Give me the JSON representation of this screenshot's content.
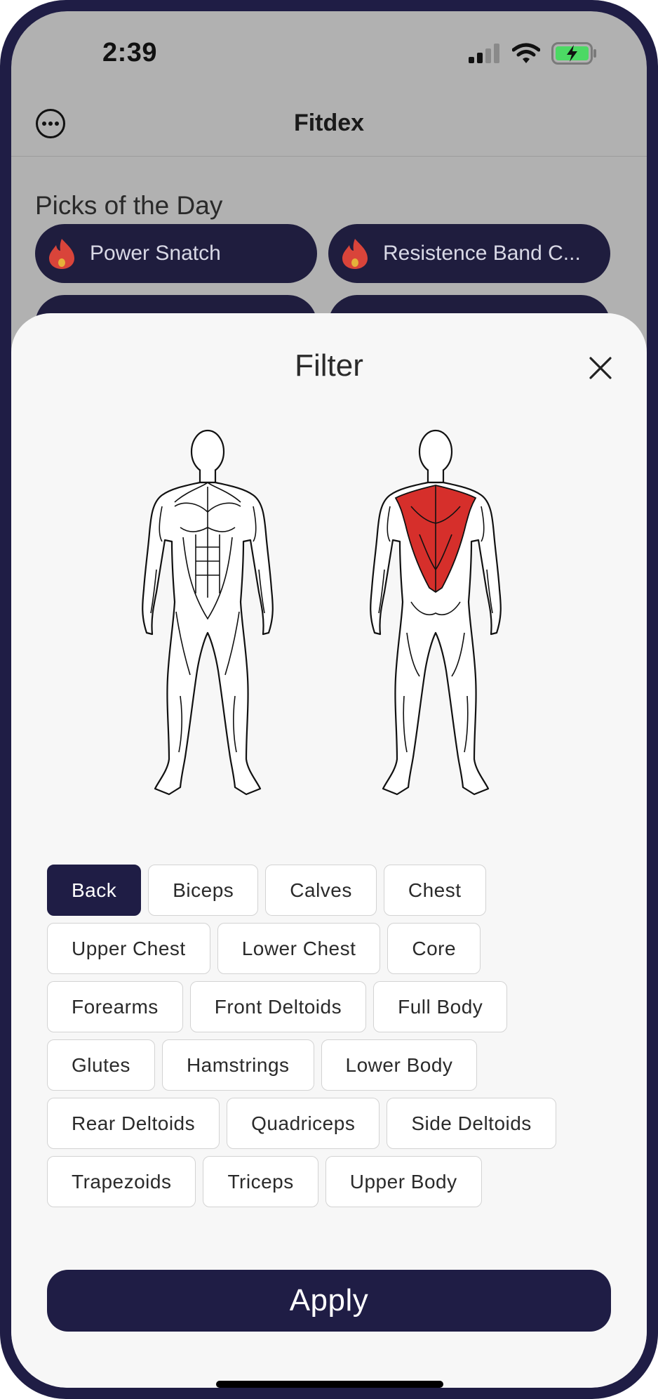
{
  "status_bar": {
    "time": "2:39",
    "icons": [
      "cellular-signal-icon",
      "wifi-icon",
      "battery-charging-icon"
    ],
    "battery_color": "#4cd964"
  },
  "header": {
    "title": "Fitdex",
    "menu_icon": "more-options-icon"
  },
  "picks": {
    "title": "Picks of the Day",
    "items": [
      "Power Snatch",
      "Resistence Band C..."
    ],
    "flame_color": "#d9443a"
  },
  "filter": {
    "title": "Filter",
    "close_icon": "close-icon",
    "diagram": {
      "front_icon": "body-front-icon",
      "back_icon": "body-back-icon",
      "highlight_color": "#d62f2b",
      "highlighted_muscle": "Back"
    },
    "chip_rows": [
      [
        "Back",
        "Biceps",
        "Calves",
        "Chest"
      ],
      [
        "Upper Chest",
        "Lower Chest",
        "Core"
      ],
      [
        "Forearms",
        "Front Deltoids",
        "Full Body"
      ],
      [
        "Glutes",
        "Hamstrings",
        "Lower Body"
      ],
      [
        "Rear Deltoids",
        "Quadriceps",
        "Side Deltoids"
      ],
      [
        "Trapezoids",
        "Triceps",
        "Upper Body"
      ]
    ],
    "selected": [
      "Back"
    ],
    "apply_label": "Apply"
  },
  "colors": {
    "primary": "#1f1d45",
    "overlay_background": "#b1b1b1",
    "sheet_background": "#f7f7f7"
  }
}
